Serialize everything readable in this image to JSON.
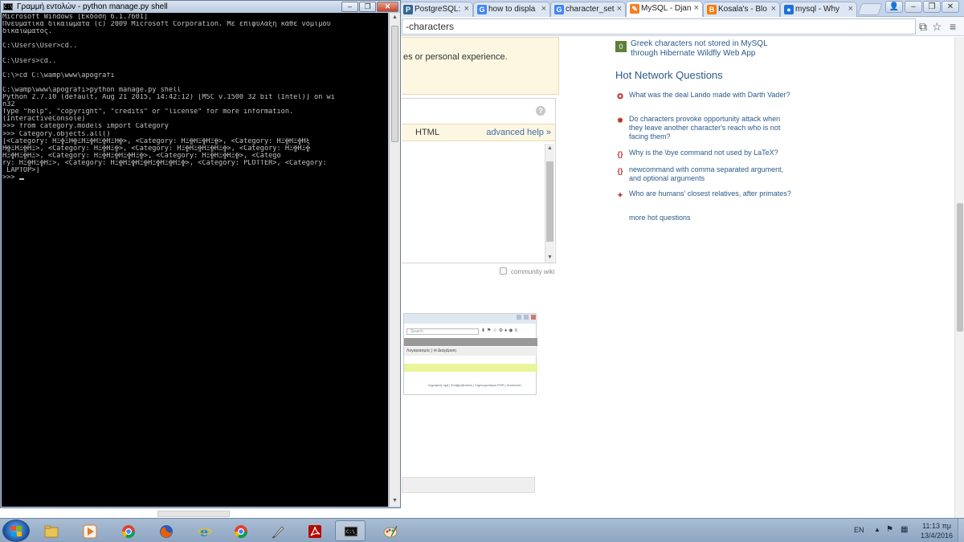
{
  "browser": {
    "tabs": [
      {
        "label": "PostgreSQL: ",
        "favicon": "P",
        "favicon_color": "#336791"
      },
      {
        "label": "how to displa",
        "favicon": "G",
        "favicon_color": "#4285f4"
      },
      {
        "label": "character_set",
        "favicon": "G",
        "favicon_color": "#4285f4"
      },
      {
        "label": "MySQL - Djan",
        "favicon": "✎",
        "favicon_color": "#f48024"
      },
      {
        "label": "Kosala's - Blo",
        "favicon": "B",
        "favicon_color": "#f57d00"
      },
      {
        "label": "mysql - Why",
        "favicon": "●",
        "favicon_color": "#1e73d8"
      }
    ],
    "tab_close": "×",
    "window_controls": {
      "user": "👤",
      "minimize": "–",
      "restore": "❐",
      "close": "✕"
    },
    "omnibox_text": "-characters",
    "notice_text": "es or personal experience.",
    "help_glyph": "?",
    "editor_tab_html": "HTML",
    "advanced_help": "advanced help »",
    "community_wiki": "community wiki",
    "preview": {
      "search_placeholder": "Search",
      "menu_text": "Λογαριασμός  |  ✉ Διαχείριση",
      "footer_text": "Δημοφιλή τιμή | Επιβραβεύσεις | Σημειωματάριο PHP | Αποκλειστ."
    },
    "sidebar": {
      "related_score": "0",
      "related_title": "Greek characters not stored in MySQL through Hibernate Wildfly Web App",
      "hnq_title": "Hot Network Questions",
      "hnq": [
        {
          "icon": "✪",
          "title": "What was the deal Lando made with Darth Vader?"
        },
        {
          "icon": "✹",
          "title": "Do characters provoke opportunity attack when they leave another character's reach who is not facing them?"
        },
        {
          "icon": "{}",
          "title": "Why is the \\bye command not used by LaTeX?"
        },
        {
          "icon": "{}",
          "title": "newcommand with comma separated argument, and optional arguments"
        },
        {
          "icon": "✦",
          "title": "Who are humans' closest relatives, after primates?"
        }
      ],
      "more": "more hot questions"
    }
  },
  "console": {
    "title": "Γραμμή εντολών - python  manage.py shell",
    "icon_text": "C:\\",
    "controls": {
      "minimize": "–",
      "maximize": "❐",
      "close": "✕"
    },
    "lines": [
      "Microsoft Windows [Έκδοση 6.1.7601]",
      "Πνευματικά δικαιώματα (c) 2009 Microsoft Corporation. Με επιφύλαξη κάθε νόμιμου",
      "δικαιώματος.",
      "",
      "C:\\Users\\User>cd..",
      "",
      "C:\\Users>cd..",
      "",
      "C:\\>cd C:\\wamp\\www\\apografi",
      "",
      "C:\\wamp\\www\\apografi>python manage.py shell",
      "Python 2.7.10 (default, Aug 21 2015, 14:42:12) [MSC v.1500 32 bit (Intel)] on wi",
      "n32",
      "Type \"help\", \"copyright\", \"credits\" or \"license\" for more information.",
      "(InteractiveConsole)",
      ">>> from category.models import Category",
      ">>> Category.objects.all()",
      "[<Category: ΗΞ╬ΞΗ╬ΞΗΞ╬ΗΞ╬ΗΞΗ╬>, <Category: ΗΞ╬ΗΞ╬ΗΞ╬>, <Category: ΗΞ╬ΗΞ╬Ηξ",
      "Η╬ΞΗΞ╬ΗΞ>, <Category: ΗΞ╬ΗΞ╬>, <Category: ΗΞ╬ΗΞ╬ΗΞ╬ΗΞ╬>, <Category: ΗΞ╬ΗΞ╬",
      "ΗΞ╬ΗΞ╬ΗΞ>, <Category: ΗΞ╬ΗΞ╬ΗΞ╬ΗΞ╬>, <Category: ΗΞ╬ΗΞ╬ΗΞ╬>, <Catego",
      "ry: ΗΞ╬ΗΞ╬ΗΞ>, <Category: ΗΞ╬ΗΞ╬ΗΞ╬ΗΞ╬ΗΞ╬ΗΞ╬>, <Category: PLOTTER>, <Category:",
      " LAPTOP>]",
      ">>> "
    ]
  },
  "taskbar": {
    "apps": [
      {
        "name": "explorer",
        "on": false
      },
      {
        "name": "media-player",
        "on": false
      },
      {
        "name": "chrome",
        "on": false
      },
      {
        "name": "firefox",
        "on": false
      },
      {
        "name": "internet-explorer",
        "on": false
      },
      {
        "name": "chrome-2",
        "on": false
      },
      {
        "name": "quill-app",
        "on": false
      },
      {
        "name": "acrobat",
        "on": false
      },
      {
        "name": "command-prompt",
        "on": true
      },
      {
        "name": "paint",
        "on": false
      }
    ],
    "lang": "EN",
    "time": "11:13 πμ",
    "date": "13/4/2016"
  }
}
